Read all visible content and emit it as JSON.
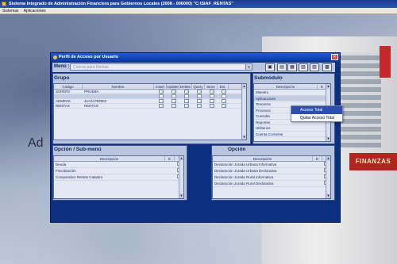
{
  "app": {
    "title": "Sistema Integrado de Administración Financiera para Gobiernos Locales (2008 - 006000)  \"C:\\SIAF_RENTAS\"",
    "menus": [
      "Sistemas",
      "Aplicaciones"
    ]
  },
  "desktop": {
    "watermark": "Ad",
    "building_sign": "FINANZAS"
  },
  "window": {
    "title": "Perfil de Acceso por Usuario",
    "close_glyph": "✕"
  },
  "menu_selector": {
    "label": "Menú :",
    "value": "Cobros para Rentas",
    "arrow": "▼"
  },
  "toolbar": {
    "buttons": [
      "▣",
      "▤",
      "▦",
      "▧",
      "▨",
      "▩"
    ]
  },
  "grupo": {
    "title": "Grupo",
    "columns": [
      "Código",
      "Nombre",
      "Insert",
      "Update",
      "Delete",
      "Query",
      "Store",
      "Est."
    ],
    "rows": [
      {
        "codigo": "SUPERV",
        "nombre": "PRUEBA",
        "perms": [
          true,
          true,
          true,
          true,
          true,
          true
        ]
      },
      {
        "codigo": "",
        "nombre": "",
        "perms": [
          false,
          false,
          false,
          false,
          false,
          false
        ]
      },
      {
        "codigo": "ADMINIS",
        "nombre": "JUAN PEREZ",
        "perms": [
          true,
          true,
          true,
          true,
          true,
          true
        ]
      },
      {
        "codigo": "RENTAS",
        "nombre": "RENTAS",
        "perms": [
          true,
          true,
          true,
          true,
          true,
          true
        ]
      }
    ]
  },
  "submodulo": {
    "title": "Submódulo",
    "columns": [
      "Descripción",
      "E"
    ],
    "items": [
      "Maestro",
      "Aplicaciones",
      "Tesorería",
      "Procesos",
      "Consulta",
      "Reportes",
      "Utilitarios",
      "Cuenta Corriente"
    ]
  },
  "context_menu": {
    "items": [
      "Acceso Total",
      "Quitar Acceso Total"
    ]
  },
  "opcion_submenu": {
    "title": "Opción / Sub-menú",
    "columns": [
      "Descripción",
      "E"
    ],
    "rows": [
      "Deuda",
      "Fiscalización",
      "Comparativo Rentas Catastro"
    ]
  },
  "opcion": {
    "title": "Opción",
    "columns": [
      "Descripción",
      "E"
    ],
    "rows": [
      "Declaración Jurada Urbana Informativa",
      "Declaración Jurada Urbana Declarativa",
      "Declaración Jurada Rural Informativa",
      "Declaración Jurada Rural Declarativa"
    ]
  }
}
